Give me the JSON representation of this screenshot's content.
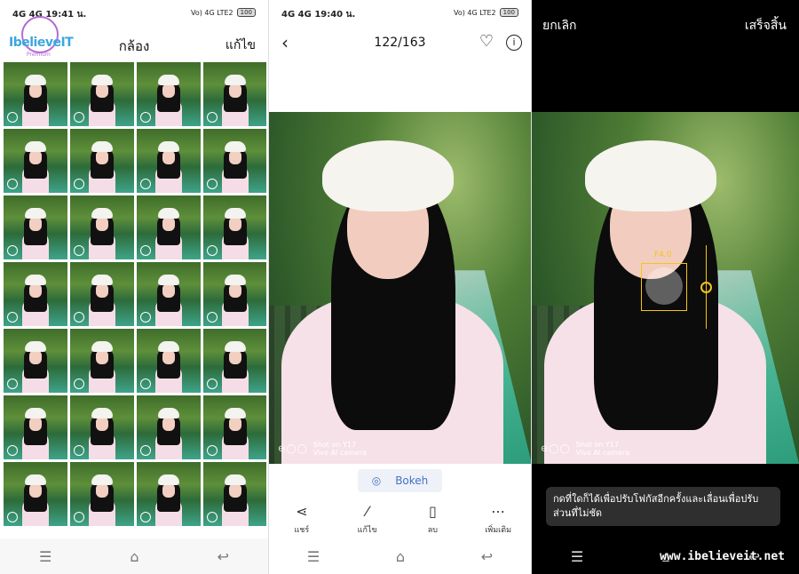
{
  "panel1": {
    "status": {
      "time": "19:41 น.",
      "net": "4G 4G",
      "volte": "Vo) 4G LTE2",
      "battery": "100"
    },
    "logo": {
      "text": "IbelieveIT",
      "sub": "Premium"
    },
    "title": "กล้อง",
    "edit_label": "แก้ไข",
    "thumbnail_count": 28
  },
  "panel2": {
    "status": {
      "time": "19:40 น.",
      "net": "4G 4G",
      "volte": "Vo) 4G LTE2",
      "battery": "100"
    },
    "counter": "122/163",
    "watermark": {
      "line1": "Shot on Y17",
      "line2": "Vivo AI camera"
    },
    "bokeh_label": "Bokeh",
    "actions": [
      {
        "name": "share",
        "icon": "share-icon",
        "label": "แชร์"
      },
      {
        "name": "edit",
        "icon": "magic-wand-icon",
        "label": "แก้ไข"
      },
      {
        "name": "delete",
        "icon": "trash-icon",
        "label": "ลบ"
      },
      {
        "name": "more",
        "icon": "more-icon",
        "label": "เพิ่มเติม"
      }
    ]
  },
  "panel3": {
    "cancel_label": "ยกเลิก",
    "done_label": "เสร็จสิ้น",
    "fnumber": "F4.0",
    "watermark": {
      "line1": "Shot on Y17",
      "line2": "Vivo AI camera"
    },
    "tip": "กดที่ใดก็ได้เพื่อปรับโฟกัสอีกครั้งและเลื่อนเพื่อปรับส่วนที่ไม่ชัด",
    "site": "www.ibelieveit.net"
  },
  "nav": {
    "menu": "☰",
    "home": "⌂",
    "back": "↩"
  },
  "colors": {
    "accent_yellow": "#f5c518",
    "bokeh_blue": "#4670c8"
  }
}
